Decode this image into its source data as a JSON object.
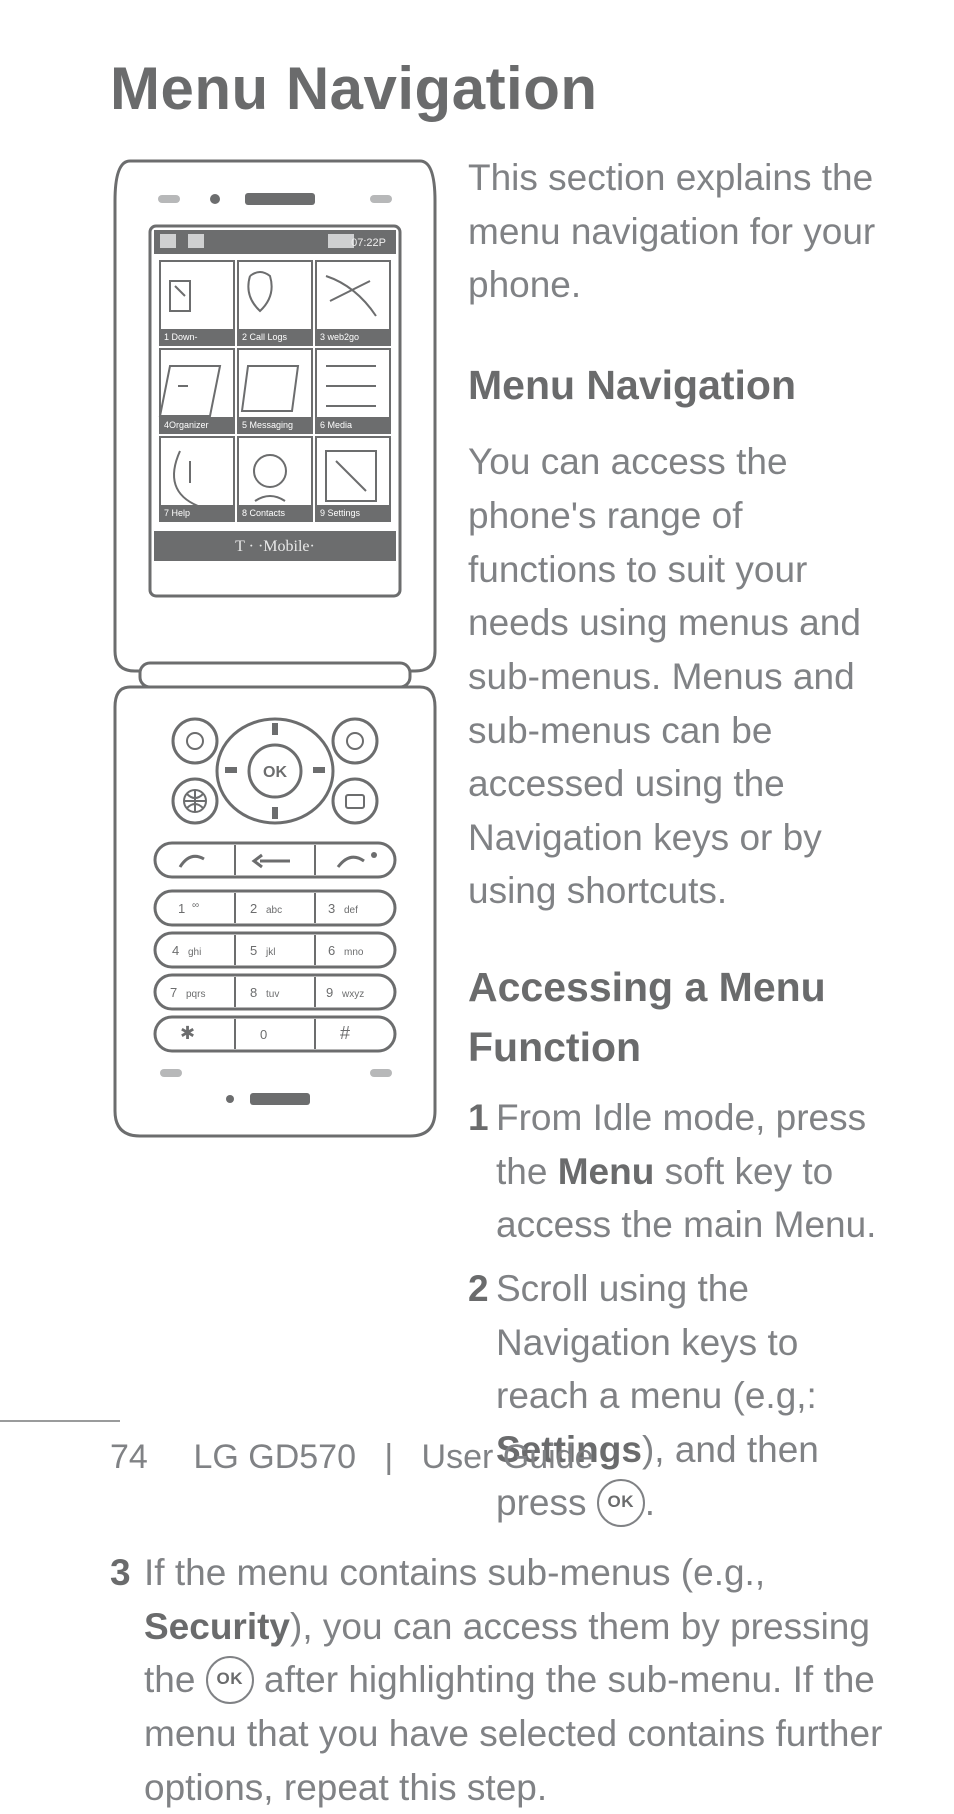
{
  "page_title": "Menu Navigation",
  "intro": "This section explains the menu navigation for your phone.",
  "section1_heading": "Menu Navigation",
  "section1_body": "You can access the phone's range of functions to suit your needs using menus and sub-menus. Menus and sub-menus can be accessed using the Navigation keys or by using shortcuts.",
  "section2_heading": "Accessing a Menu Function",
  "steps": {
    "s1_pre": "From Idle mode, press the ",
    "s1_bold": "Menu",
    "s1_post": " soft key to access the main Menu.",
    "s2_pre": "Scroll using the Navigation keys to reach a menu (e.g,: ",
    "s2_bold": "Settings",
    "s2_mid": "), and then press ",
    "s2_ok": "OK",
    "s2_post": ".",
    "s3_pre": "If the menu contains sub-menus (e.g., ",
    "s3_bold": "Security",
    "s3_mid1": "), you can access them by pressing the ",
    "s3_ok": "OK",
    "s3_mid2": " after highlighting the sub-menu. If the menu that you have selected contains further options, repeat this step."
  },
  "footer": {
    "page_number": "74",
    "product": "LG GD570",
    "separator": "|",
    "doc_title": "User Guide"
  },
  "phone": {
    "carrier": "T · ·Mobile·",
    "status_time": "07:22P",
    "menu_items": [
      {
        "n": "1",
        "label": "Down-\nloads"
      },
      {
        "n": "2",
        "label": "Call Logs"
      },
      {
        "n": "3",
        "label": "web2go"
      },
      {
        "n": "4",
        "label": "Organizer"
      },
      {
        "n": "5",
        "label": "Messaging"
      },
      {
        "n": "6",
        "label": "Media"
      },
      {
        "n": "7",
        "label": "Help"
      },
      {
        "n": "8",
        "label": "Contacts"
      },
      {
        "n": "9",
        "label": "Settings"
      }
    ],
    "keys": {
      "ok": "OK",
      "row1": [
        "1",
        "2 abc",
        "3 def"
      ],
      "row2": [
        "4 ghi",
        "5 jkl",
        "6 mno"
      ],
      "row3": [
        "7 pqrs",
        "8 tuv",
        "9 wxyz"
      ],
      "row4": [
        "*",
        "0",
        "#"
      ]
    }
  }
}
